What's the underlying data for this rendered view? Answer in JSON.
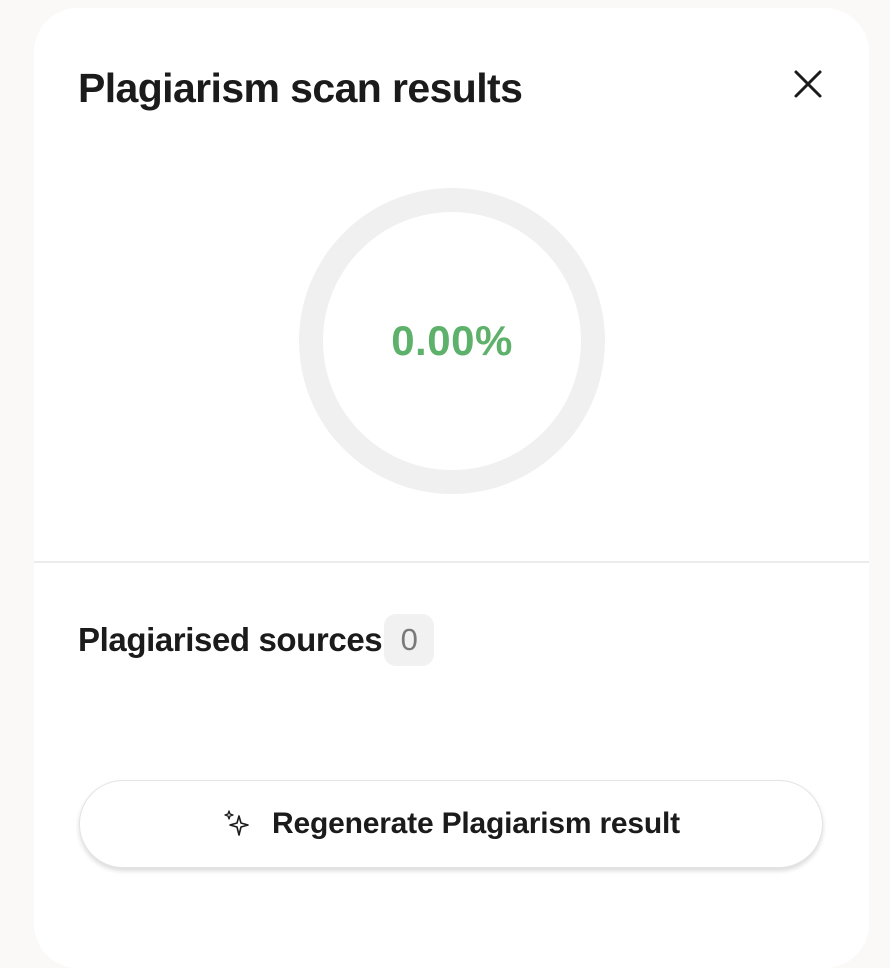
{
  "dialog": {
    "title": "Plagiarism scan results",
    "close_icon": "close-icon"
  },
  "score": {
    "text": "0.00%",
    "value": 0,
    "color": "#5db16a",
    "track_color": "#f0f0f0"
  },
  "sources": {
    "label": "Plagiarised sources",
    "count": "0"
  },
  "actions": {
    "regenerate_label": "Regenerate Plagiarism result",
    "regenerate_icon": "sparkles-icon"
  }
}
